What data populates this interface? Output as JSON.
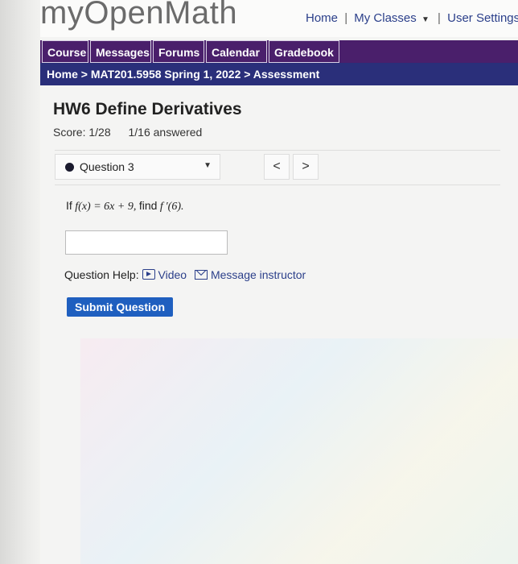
{
  "app": {
    "logo": "myOpenMath"
  },
  "topnav": {
    "home": "Home",
    "sep": "|",
    "my_classes": "My Classes",
    "user_settings": "User Settings"
  },
  "menu": {
    "items": [
      "Course",
      "Messages",
      "Forums",
      "Calendar",
      "Gradebook"
    ]
  },
  "breadcrumb": {
    "text": "Home > MAT201.5958 Spring 1, 2022 > Assessment"
  },
  "assessment": {
    "title": "HW6 Define Derivatives",
    "score": "Score: 1/28",
    "answered": "1/16 answered"
  },
  "question_nav": {
    "selected": "Question 3",
    "prev": "<",
    "next": ">"
  },
  "question": {
    "prefix": "If",
    "expr": "f(x) = 6x + 9,",
    "mid": "find",
    "target": "f ′(6)."
  },
  "answer": {
    "value": ""
  },
  "help": {
    "label": "Question Help:",
    "video": "Video",
    "message": "Message instructor"
  },
  "submit": {
    "label": "Submit Question"
  },
  "colors": {
    "menu_bar": "#4a1f6b",
    "breadcrumb_bar": "#2a2f7a",
    "submit_button": "#1f5fbf",
    "link": "#2b3f8a"
  }
}
